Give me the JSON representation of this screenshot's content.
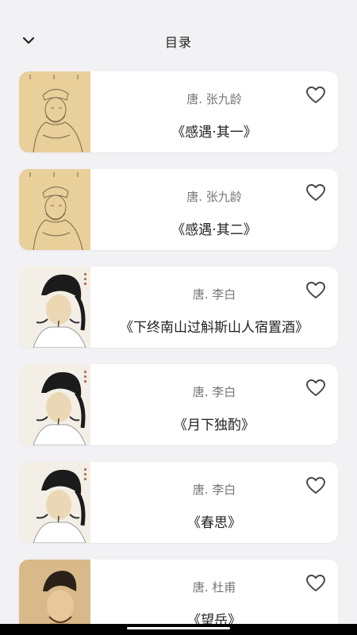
{
  "header": {
    "title": "目录",
    "back_icon": "chevron-down-icon"
  },
  "poems": [
    {
      "author": "唐. 张九龄",
      "title": "《感遇·其一》",
      "portrait": "zhang-jiuling",
      "favorite": false
    },
    {
      "author": "唐. 张九龄",
      "title": "《感遇·其二》",
      "portrait": "zhang-jiuling",
      "favorite": false
    },
    {
      "author": "唐. 李白",
      "title": "《下终南山过斛斯山人宿置酒》",
      "portrait": "li-bai",
      "favorite": false
    },
    {
      "author": "唐. 李白",
      "title": "《月下独酌》",
      "portrait": "li-bai",
      "favorite": false
    },
    {
      "author": "唐. 李白",
      "title": "《春思》",
      "portrait": "li-bai",
      "favorite": false
    },
    {
      "author": "唐. 杜甫",
      "title": "《望岳》",
      "portrait": "du-fu",
      "favorite": false
    }
  ],
  "colors": {
    "background": "#f2f1f4",
    "card": "#ffffff",
    "author_text": "#777777",
    "title_text": "#222222",
    "icon": "#444444"
  }
}
